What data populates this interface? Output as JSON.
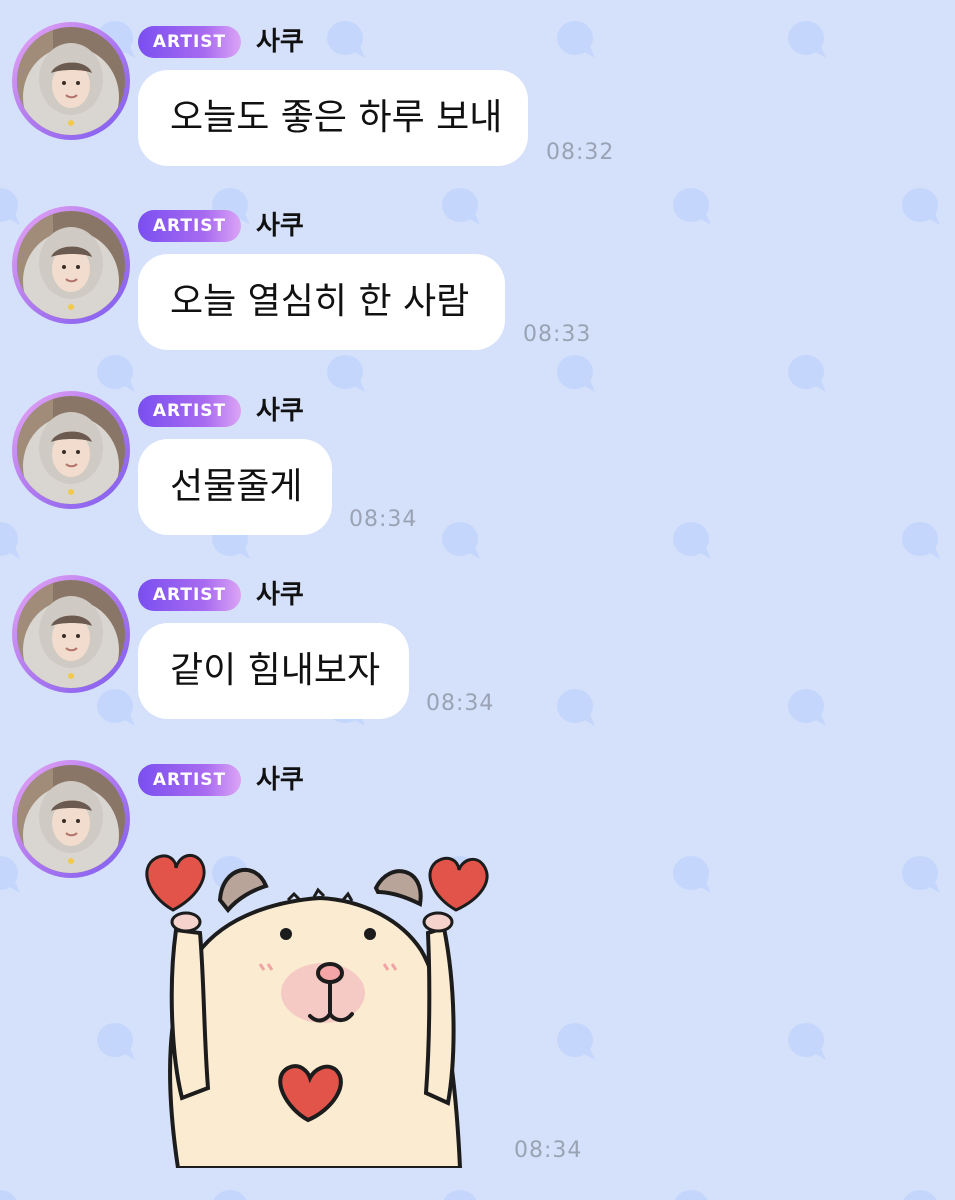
{
  "artist_badge": "ARTIST",
  "sender_name": "사쿠",
  "messages": [
    {
      "text": "오늘도 좋은 하루 보내",
      "time": "08:32"
    },
    {
      "text": "오늘 열심히 한 사람",
      "time": "08:33"
    },
    {
      "text": "선물줄게",
      "time": "08:34"
    },
    {
      "text": "같이 힘내보자",
      "time": "08:34"
    }
  ],
  "sticker_message": {
    "time": "08:34",
    "sticker": "bear-holding-hearts-sticker"
  },
  "colors": {
    "background": "#d5e1fb",
    "pattern_bubble": "#c4d6fb",
    "badge_gradient_start": "#7a4ff0",
    "badge_gradient_end": "#dba4f5",
    "bubble": "#ffffff",
    "timestamp": "#9aa3b4"
  }
}
